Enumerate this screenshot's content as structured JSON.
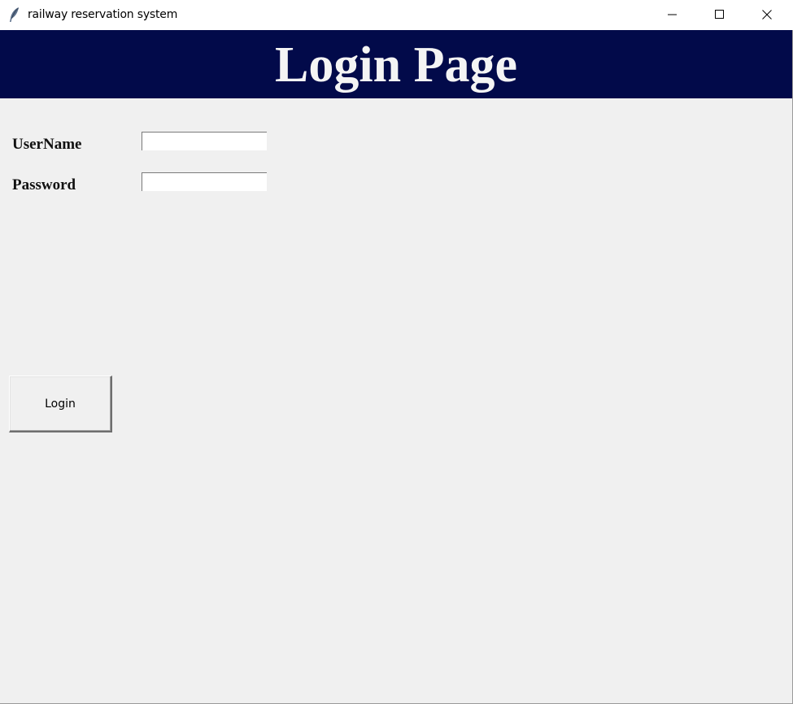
{
  "window": {
    "title": "railway reservation system",
    "app_icon": "feather-icon",
    "controls": {
      "minimize_icon": "minimize-icon",
      "maximize_icon": "maximize-icon",
      "close_icon": "close-icon"
    }
  },
  "header": {
    "title": "Login Page",
    "background_color": "#020a4a",
    "text_color": "#f4f4f4"
  },
  "form": {
    "username_label": "UserName",
    "username_value": "",
    "password_label": "Password",
    "password_value": "",
    "login_button_label": "Login"
  },
  "colors": {
    "window_background": "#f0f0f0"
  }
}
